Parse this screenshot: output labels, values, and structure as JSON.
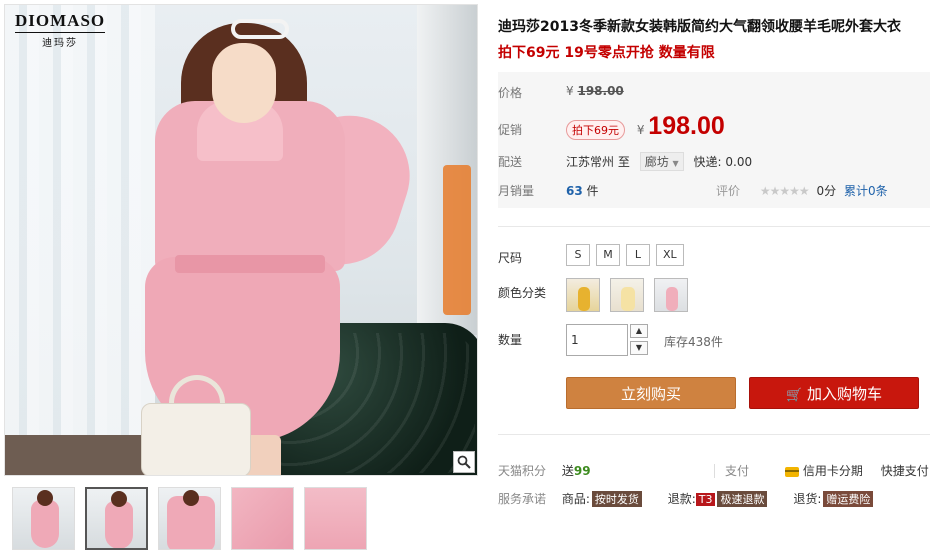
{
  "brand": {
    "name": "DIOMASO",
    "sub": "迪玛莎"
  },
  "product": {
    "title": "迪玛莎2013冬季新款女装韩版简约大气翻领收腰羊毛呢外套大衣",
    "promo_line": "拍下69元 19号零点开抢 数量有限"
  },
  "price": {
    "original_label": "价格",
    "currency": "¥",
    "original_value": "198.00",
    "promo_label": "促销",
    "promo_tag": "拍下69元",
    "promo_value": "198.00"
  },
  "shipping": {
    "label": "配送",
    "from": "江苏常州",
    "to_word": "至",
    "destination": "廊坊",
    "express": "快递: 0.00"
  },
  "sales": {
    "label": "月销量",
    "count": "63",
    "unit": "件",
    "rating_label": "评价",
    "stars": "★★★★★",
    "score": "0分",
    "total_prefix": "累计",
    "total_count": "0条"
  },
  "sizes": {
    "label": "尺码",
    "options": [
      "S",
      "M",
      "L",
      "XL"
    ]
  },
  "colors": {
    "label": "颜色分类"
  },
  "quantity": {
    "label": "数量",
    "value": "1",
    "up_arrow": "▲",
    "down_arrow": "▼",
    "stock": "库存438件"
  },
  "actions": {
    "buy_now": "立刻购买",
    "add_to_cart": "加入购物车",
    "cart_glyph": "🛒"
  },
  "points": {
    "label": "天猫积分",
    "prefix": "送",
    "value": "99",
    "payment_label": "支付",
    "credit_installment": "信用卡分期",
    "express_pay": "快捷支付"
  },
  "service": {
    "label": "服务承诺",
    "goods_label": "商品:",
    "goods_tag": "按时发货",
    "refund_label": "退款:",
    "refund_badge": "T3",
    "refund_tag": "极速退款",
    "return_label": "退货:",
    "return_tag": "赠运费险"
  }
}
